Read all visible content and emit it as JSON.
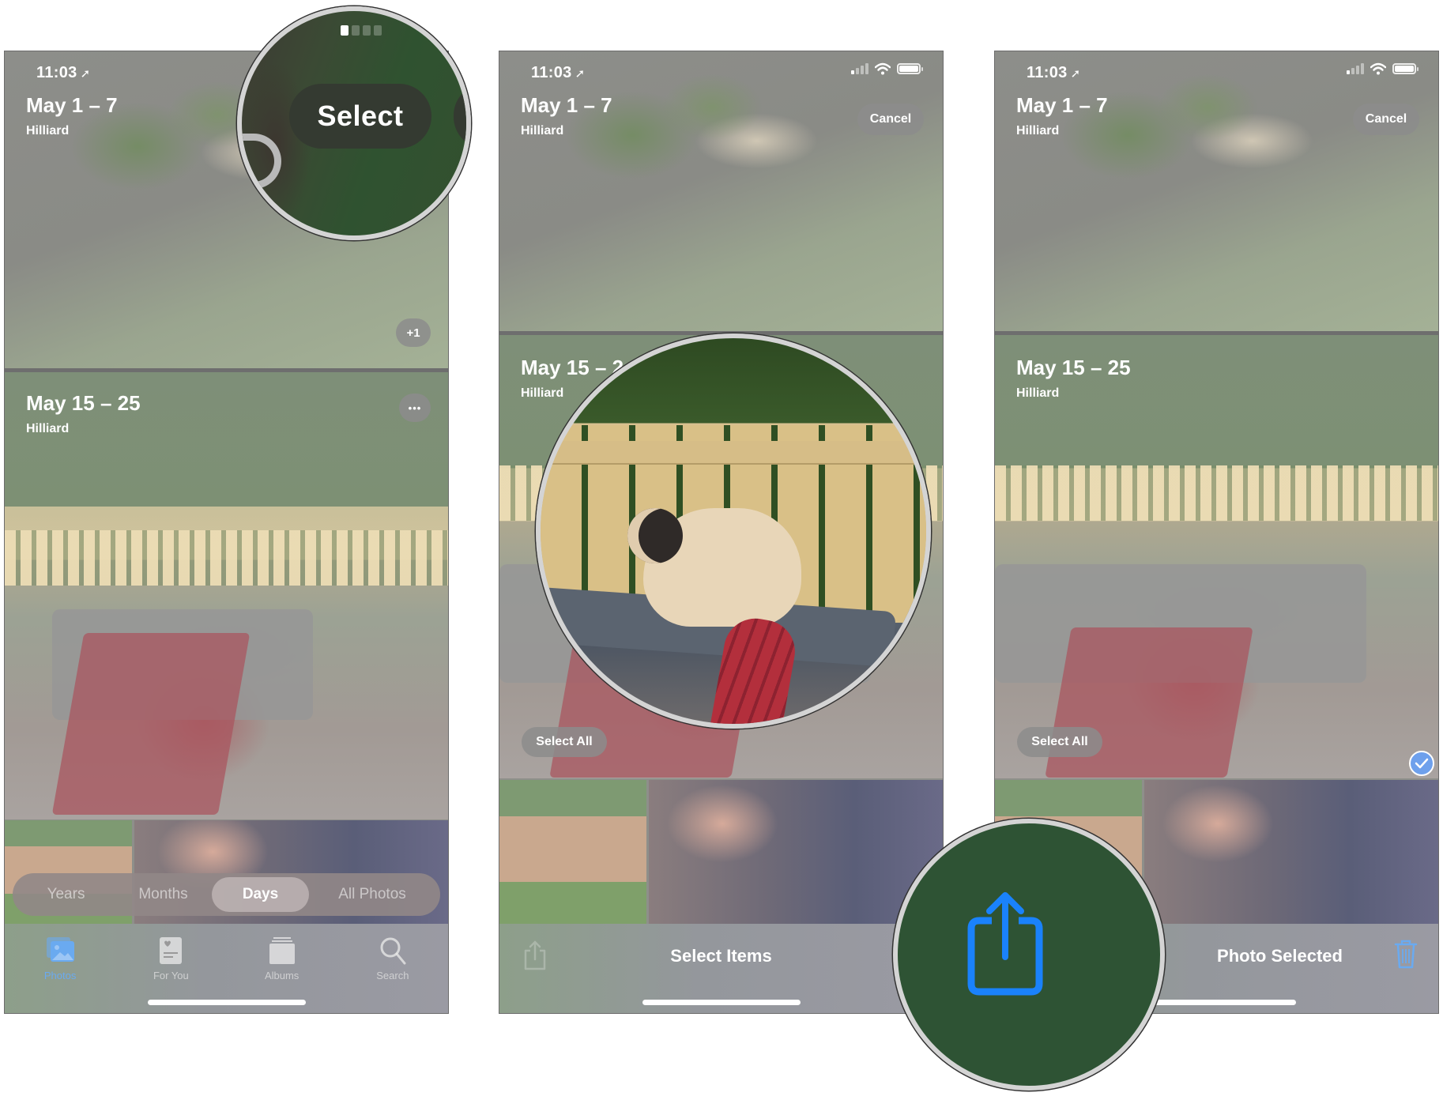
{
  "colors": {
    "ios_blue": "#1a82fb",
    "tab_active": "#6aaaf0",
    "magnifier_ring": "#d4d4d4",
    "check_badge": "#6ea0ec"
  },
  "panels": [
    {
      "status": {
        "time": "11:03",
        "location_icon": "location-arrow-icon"
      },
      "sections": [
        {
          "title": "May 1 – 7",
          "location": "Hilliard",
          "badge": "+1"
        },
        {
          "title": "May 15 – 25",
          "location": "Hilliard",
          "more_label": "•••"
        }
      ],
      "segmented": {
        "options": [
          "Years",
          "Months",
          "Days",
          "All Photos"
        ],
        "selected": "Days"
      },
      "tabs": [
        {
          "label": "Photos",
          "icon": "photos-icon",
          "active": true
        },
        {
          "label": "For You",
          "icon": "for-you-icon",
          "active": false
        },
        {
          "label": "Albums",
          "icon": "albums-icon",
          "active": false
        },
        {
          "label": "Search",
          "icon": "search-icon",
          "active": false
        }
      ],
      "magnifier": {
        "label": "Select"
      }
    },
    {
      "status": {
        "time": "11:03",
        "location_icon": "location-arrow-icon"
      },
      "header_button": "Cancel",
      "sections": [
        {
          "title": "May 1 – 7",
          "location": "Hilliard"
        },
        {
          "title": "May 15 – 2",
          "location": "Hilliard"
        }
      ],
      "select_all": "Select All",
      "bottom_bar": {
        "center_text": "Select Items",
        "left_icon": "share-icon"
      }
    },
    {
      "status": {
        "time": "11:03",
        "location_icon": "location-arrow-icon"
      },
      "header_button": "Cancel",
      "sections": [
        {
          "title": "May 1 – 7",
          "location": "Hilliard"
        },
        {
          "title": "May 15 – 25",
          "location": "Hilliard"
        }
      ],
      "select_all": "Select All",
      "selected_check": true,
      "bottom_bar": {
        "center_text": "Photo Selected",
        "right_icon": "trash-icon"
      },
      "magnifier": {
        "icon": "share-icon"
      }
    }
  ]
}
